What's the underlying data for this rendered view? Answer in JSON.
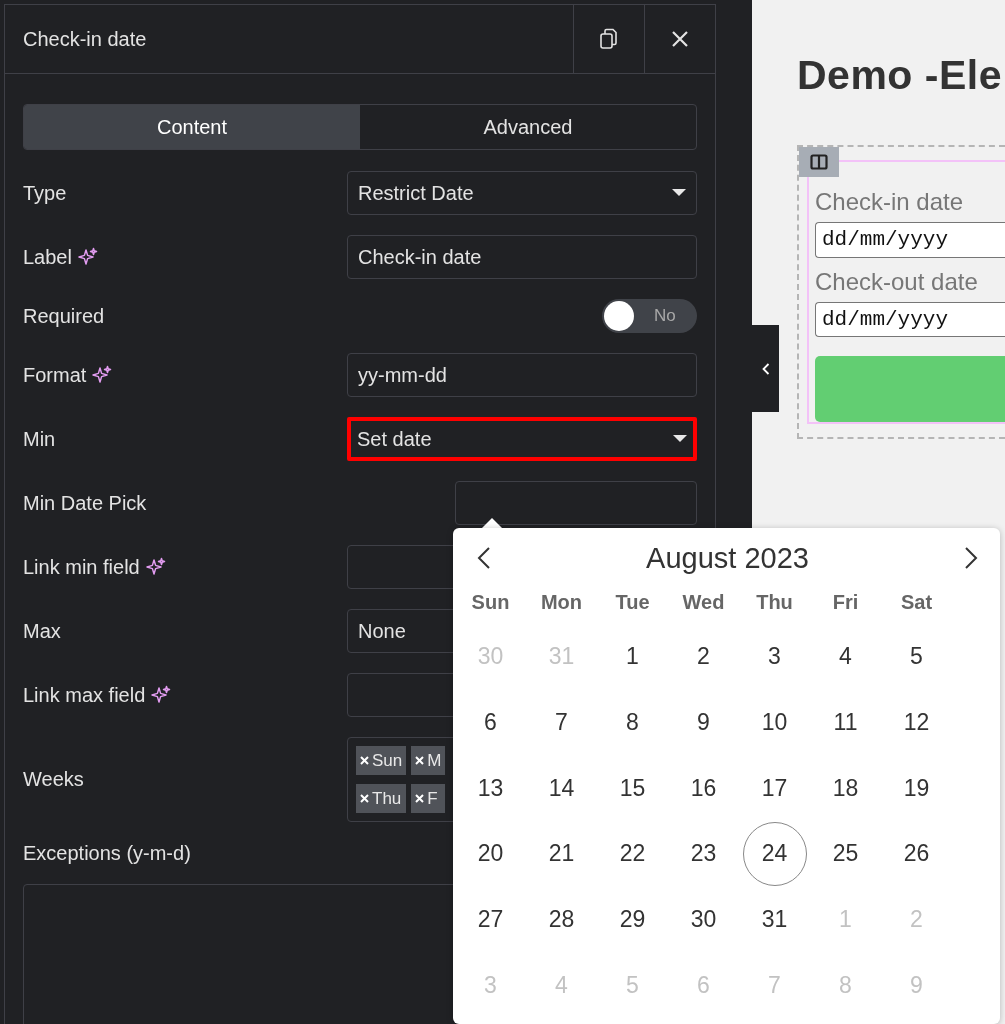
{
  "panel": {
    "title": "Check-in date",
    "tabs": [
      {
        "label": "Content",
        "selected": true
      },
      {
        "label": "Advanced",
        "selected": false
      }
    ],
    "rows": [
      {
        "kind": "select",
        "label": "Type",
        "ai": false,
        "value": "Restrict Date",
        "highlighted": false
      },
      {
        "kind": "text",
        "label": "Label",
        "ai": true,
        "value": "Check-in date"
      },
      {
        "kind": "toggle",
        "label": "Required",
        "ai": false,
        "on": false,
        "state_text": "No"
      },
      {
        "kind": "text",
        "label": "Format",
        "ai": true,
        "value": "yy-mm-dd"
      },
      {
        "kind": "select",
        "label": "Min",
        "ai": false,
        "value": "Set date",
        "highlighted": true
      },
      {
        "kind": "date",
        "label": "Min Date Pick",
        "ai": false
      },
      {
        "kind": "text",
        "label": "Link min field",
        "ai": true
      },
      {
        "kind": "select",
        "label": "Max",
        "ai": false,
        "value": "None",
        "highlighted": false
      },
      {
        "kind": "text",
        "label": "Link max field",
        "ai": true
      },
      {
        "kind": "chips",
        "label": "Weeks",
        "ai": false,
        "chips": [
          "Sun",
          "M",
          "Thu",
          "F"
        ]
      },
      {
        "kind": "textarea",
        "label": "Exceptions (y-m-d)",
        "ai": false
      }
    ]
  },
  "calendar": {
    "month": "August 2023",
    "weekdays": [
      "Sun",
      "Mon",
      "Tue",
      "Wed",
      "Thu",
      "Fri",
      "Sat"
    ],
    "weeks": [
      [
        {
          "d": "30",
          "outside": true,
          "today": false
        },
        {
          "d": "31",
          "outside": true,
          "today": false
        },
        {
          "d": "1",
          "outside": false,
          "today": false
        },
        {
          "d": "2",
          "outside": false,
          "today": false
        },
        {
          "d": "3",
          "outside": false,
          "today": false
        },
        {
          "d": "4",
          "outside": false,
          "today": false
        },
        {
          "d": "5",
          "outside": false,
          "today": false
        }
      ],
      [
        {
          "d": "6",
          "outside": false,
          "today": false
        },
        {
          "d": "7",
          "outside": false,
          "today": false
        },
        {
          "d": "8",
          "outside": false,
          "today": false
        },
        {
          "d": "9",
          "outside": false,
          "today": false
        },
        {
          "d": "10",
          "outside": false,
          "today": false
        },
        {
          "d": "11",
          "outside": false,
          "today": false
        },
        {
          "d": "12",
          "outside": false,
          "today": false
        }
      ],
      [
        {
          "d": "13",
          "outside": false,
          "today": false
        },
        {
          "d": "14",
          "outside": false,
          "today": false
        },
        {
          "d": "15",
          "outside": false,
          "today": false
        },
        {
          "d": "16",
          "outside": false,
          "today": false
        },
        {
          "d": "17",
          "outside": false,
          "today": false
        },
        {
          "d": "18",
          "outside": false,
          "today": false
        },
        {
          "d": "19",
          "outside": false,
          "today": false
        }
      ],
      [
        {
          "d": "20",
          "outside": false,
          "today": false
        },
        {
          "d": "21",
          "outside": false,
          "today": false
        },
        {
          "d": "22",
          "outside": false,
          "today": false
        },
        {
          "d": "23",
          "outside": false,
          "today": false
        },
        {
          "d": "24",
          "outside": false,
          "today": true
        },
        {
          "d": "25",
          "outside": false,
          "today": false
        },
        {
          "d": "26",
          "outside": false,
          "today": false
        }
      ],
      [
        {
          "d": "27",
          "outside": false,
          "today": false
        },
        {
          "d": "28",
          "outside": false,
          "today": false
        },
        {
          "d": "29",
          "outside": false,
          "today": false
        },
        {
          "d": "30",
          "outside": false,
          "today": false
        },
        {
          "d": "31",
          "outside": false,
          "today": false
        },
        {
          "d": "1",
          "outside": true,
          "today": false
        },
        {
          "d": "2",
          "outside": true,
          "today": false
        }
      ],
      [
        {
          "d": "3",
          "outside": true,
          "today": false
        },
        {
          "d": "4",
          "outside": true,
          "today": false
        },
        {
          "d": "5",
          "outside": true,
          "today": false
        },
        {
          "d": "6",
          "outside": true,
          "today": false
        },
        {
          "d": "7",
          "outside": true,
          "today": false
        },
        {
          "d": "8",
          "outside": true,
          "today": false
        },
        {
          "d": "9",
          "outside": true,
          "today": false
        }
      ]
    ]
  },
  "canvas": {
    "heading": "Demo -Ele",
    "fields": [
      {
        "label": "Check-in date",
        "placeholder": "dd/mm/yyyy"
      },
      {
        "label": "Check-out date",
        "placeholder": "dd/mm/yyyy"
      }
    ]
  }
}
